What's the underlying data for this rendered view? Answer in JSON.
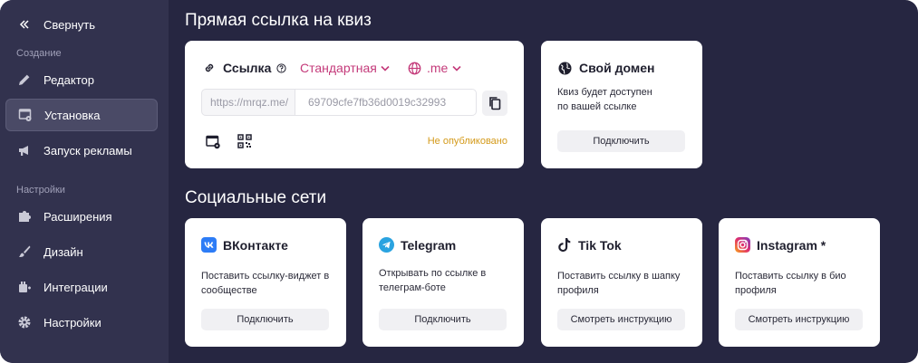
{
  "sidebar": {
    "collapse_label": "Свернуть",
    "section_create": "Создание",
    "section_settings": "Настройки",
    "items": [
      {
        "label": "Редактор"
      },
      {
        "label": "Установка"
      },
      {
        "label": "Запуск рекламы"
      },
      {
        "label": "Расширения"
      },
      {
        "label": "Дизайн"
      },
      {
        "label": "Интеграции"
      },
      {
        "label": "Настройки"
      }
    ]
  },
  "direct_link": {
    "section_title": "Прямая ссылка на квиз",
    "card_title": "Ссылка",
    "type_dropdown": "Стандартная",
    "domain_dropdown": ".me",
    "url_prefix": "https://mrqz.me/",
    "url_id": "69709cfe7fb36d0019c32993",
    "status": "Не опубликовано"
  },
  "custom_domain": {
    "title": "Свой домен",
    "text_line1": "Квиз будет доступен",
    "text_line2": "по вашей ссылке",
    "button": "Подключить"
  },
  "social": {
    "section_title": "Социальные сети",
    "cards": [
      {
        "title": "ВКонтакте",
        "line1": "Поставить ссылку-виджет в",
        "line2": "сообществе",
        "button": "Подключить"
      },
      {
        "title": "Telegram",
        "line1": "Открывать по ссылке в",
        "line2": "телеграм-боте",
        "button": "Подключить"
      },
      {
        "title": "Tik Tok",
        "line1": "Поставить ссылку в шапку",
        "line2": "профиля",
        "button": "Смотреть инструкцию"
      },
      {
        "title": "Instagram *",
        "line1": "Поставить ссылку в био",
        "line2": "профиля",
        "button": "Смотреть инструкцию"
      }
    ]
  },
  "colors": {
    "background": "#262641",
    "sidebar": "#32324e",
    "accent": "#c43a7a",
    "status": "#d49a1a"
  }
}
